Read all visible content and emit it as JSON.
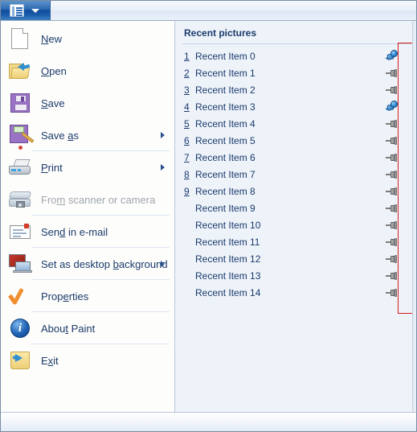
{
  "window": {
    "app_button_icon": "menu-document-icon",
    "app_button_caret": "chevron-down-icon"
  },
  "menu": {
    "items": [
      {
        "label": "New",
        "accel": "N",
        "icon": "new-document-icon",
        "disabled": false,
        "submenu": false,
        "separator": false
      },
      {
        "label": "Open",
        "accel": "O",
        "icon": "open-folder-icon",
        "disabled": false,
        "submenu": false,
        "separator": false
      },
      {
        "label": "Save",
        "accel": "S",
        "icon": "floppy-disk-icon",
        "disabled": false,
        "submenu": false,
        "separator": false
      },
      {
        "label": "Save as",
        "accel": "a",
        "icon": "save-as-icon",
        "disabled": false,
        "submenu": true,
        "separator": true
      },
      {
        "label": "Print",
        "accel": "P",
        "icon": "printer-icon",
        "disabled": false,
        "submenu": true,
        "separator": false
      },
      {
        "label": "From scanner or camera",
        "accel": "m",
        "icon": "scanner-icon",
        "disabled": true,
        "submenu": false,
        "separator": true
      },
      {
        "label": "Send in e-mail",
        "accel": "d",
        "icon": "envelope-icon",
        "disabled": false,
        "submenu": false,
        "separator": true
      },
      {
        "label": "Set as desktop background",
        "accel": "b",
        "icon": "desktop-monitor-icon",
        "disabled": false,
        "submenu": true,
        "separator": true
      },
      {
        "label": "Properties",
        "accel": "e",
        "icon": "orange-check-icon",
        "disabled": false,
        "submenu": false,
        "separator": true
      },
      {
        "label": "About Paint",
        "accel": "t",
        "icon": "info-circle-icon",
        "disabled": false,
        "submenu": false,
        "separator": true
      },
      {
        "label": "Exit",
        "accel": "x",
        "icon": "exit-folder-icon",
        "disabled": false,
        "submenu": false,
        "separator": false
      }
    ]
  },
  "recent": {
    "title": "Recent pictures",
    "items": [
      {
        "number": "1",
        "label": "Recent Item 0",
        "pinned": true
      },
      {
        "number": "2",
        "label": "Recent Item 1",
        "pinned": false
      },
      {
        "number": "3",
        "label": "Recent Item 2",
        "pinned": false
      },
      {
        "number": "4",
        "label": "Recent Item 3",
        "pinned": true
      },
      {
        "number": "5",
        "label": "Recent Item 4",
        "pinned": false
      },
      {
        "number": "6",
        "label": "Recent Item 5",
        "pinned": false
      },
      {
        "number": "7",
        "label": "Recent Item 6",
        "pinned": false
      },
      {
        "number": "8",
        "label": "Recent Item 7",
        "pinned": false
      },
      {
        "number": "9",
        "label": "Recent Item 8",
        "pinned": false
      },
      {
        "number": "",
        "label": "Recent Item 9",
        "pinned": false
      },
      {
        "number": "",
        "label": "Recent Item 10",
        "pinned": false
      },
      {
        "number": "",
        "label": "Recent Item 11",
        "pinned": false
      },
      {
        "number": "",
        "label": "Recent Item 12",
        "pinned": false
      },
      {
        "number": "",
        "label": "Recent Item 13",
        "pinned": false
      },
      {
        "number": "",
        "label": "Recent Item 14",
        "pinned": false
      }
    ],
    "pin_icon_pinned": "pushpin-pinned-icon",
    "pin_icon_unpinned": "pushpin-unpinned-icon",
    "highlight_color": "#d81b1b"
  }
}
